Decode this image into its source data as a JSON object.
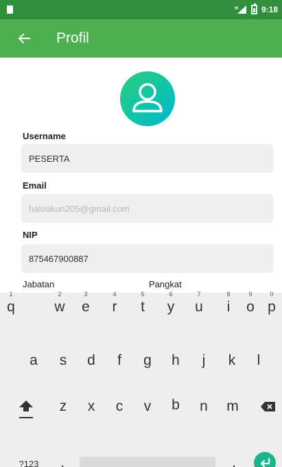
{
  "status_bar": {
    "time": "9:18",
    "network": "H"
  },
  "app_bar": {
    "title": "Profil"
  },
  "fields": {
    "username": {
      "label": "Username",
      "value": "PESERTA"
    },
    "email": {
      "label": "Email",
      "placeholder": "haloakun205@gmail.com"
    },
    "nip": {
      "label": "NIP",
      "value": "875467900887"
    }
  },
  "labels": {
    "jabatan": "Jabatan",
    "pangkat": "Pangkat"
  },
  "keyboard": {
    "row1": [
      {
        "key": "q",
        "hint": "1"
      },
      {
        "key": "w",
        "hint": "2"
      },
      {
        "key": "e",
        "hint": "3"
      },
      {
        "key": "r",
        "hint": "4"
      },
      {
        "key": "t",
        "hint": "5"
      },
      {
        "key": "y",
        "hint": "6"
      },
      {
        "key": "u",
        "hint": "7"
      },
      {
        "key": "i",
        "hint": "8"
      },
      {
        "key": "o",
        "hint": "9"
      },
      {
        "key": "p",
        "hint": "0"
      }
    ],
    "row2": [
      "a",
      "s",
      "d",
      "f",
      "g",
      "h",
      "j",
      "k",
      "l"
    ],
    "row3": [
      "z",
      "x",
      "c",
      "v",
      "b",
      "n",
      "m"
    ],
    "symbols_label": "?123",
    "comma": ",",
    "period": ".",
    "icons": {
      "shift": "shift-icon",
      "backspace": "backspace-icon",
      "enter": "enter-icon"
    },
    "accent_color": "#1db48c"
  },
  "colors": {
    "status_bar": "#2f8f3c",
    "app_bar": "#4caf50",
    "field_bg": "#f0eef1"
  }
}
